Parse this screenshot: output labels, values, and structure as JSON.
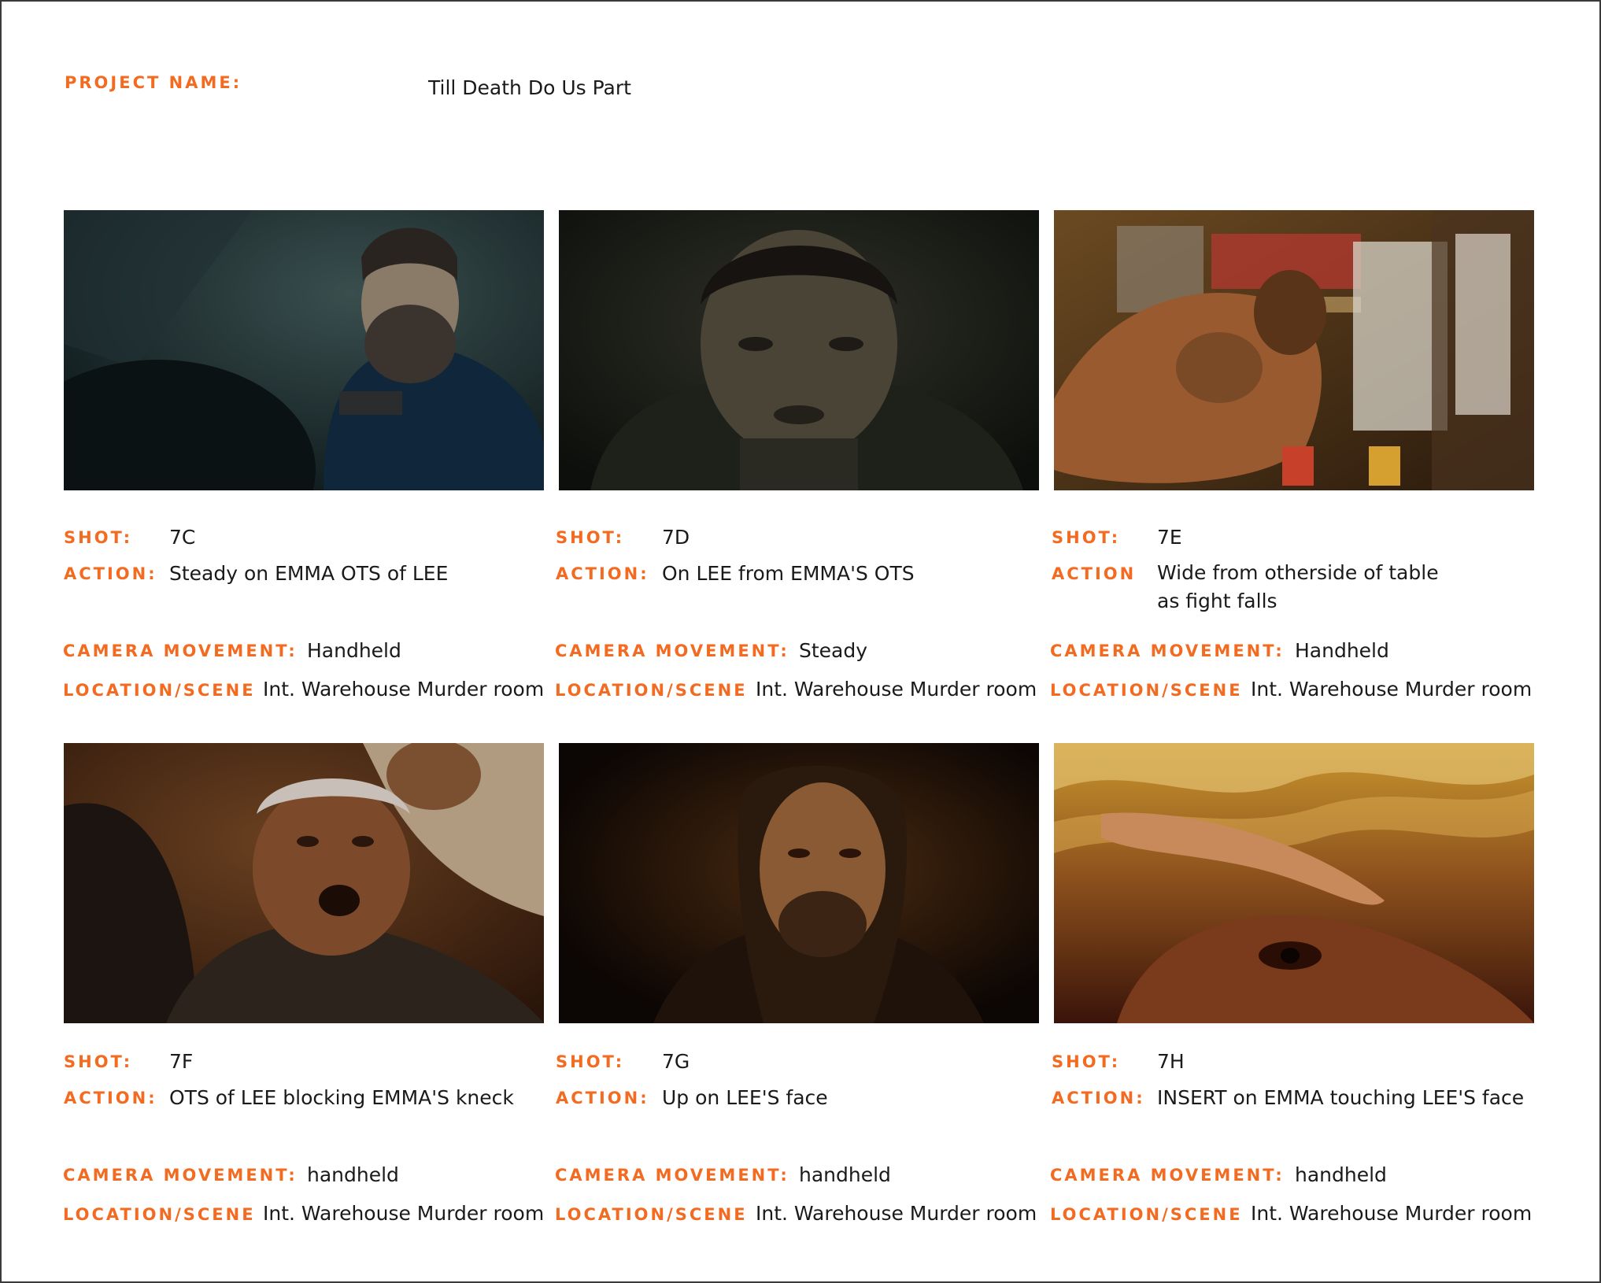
{
  "project": {
    "label": "PROJECT NAME:",
    "name": "Till Death Do Us Part"
  },
  "labels": {
    "shot": "SHOT:",
    "action": "ACTION:",
    "action_alt": "ACTION",
    "camera": "CAMERA MOVEMENT:",
    "location": "LOCATION/SCENE"
  },
  "shots": [
    {
      "shot": "7C",
      "action": "Steady on EMMA OTS of LEE",
      "camera": "Handheld",
      "location": "Int. Warehouse Murder room",
      "image": "man-with-beard-aiming-gun-teal-night"
    },
    {
      "shot": "7D",
      "action": "On LEE from EMMA'S OTS",
      "camera": "Steady",
      "location": "Int. Warehouse Murder room",
      "image": "man-face-dark-closeup"
    },
    {
      "shot": "7E",
      "action": "Wide from otherside of table as fight falls",
      "camera": "Handheld",
      "location": "Int. Warehouse Murder room",
      "image": "two-people-struggling-in-pantry"
    },
    {
      "shot": "7F",
      "action": "OTS of LEE blocking EMMA'S kneck",
      "camera": "handheld",
      "location": "Int. Warehouse Murder room",
      "image": "man-held-down-mouth-open"
    },
    {
      "shot": "7G",
      "action": "Up on LEE'S face",
      "camera": "handheld",
      "location": "Int. Warehouse Murder room",
      "image": "man-face-warm-dark-closeup"
    },
    {
      "shot": "7H",
      "action": "INSERT on EMMA touching LEE'S face",
      "camera": "handheld",
      "location": "Int. Warehouse Murder room",
      "image": "hand-touching-face-extreme-closeup"
    }
  ]
}
